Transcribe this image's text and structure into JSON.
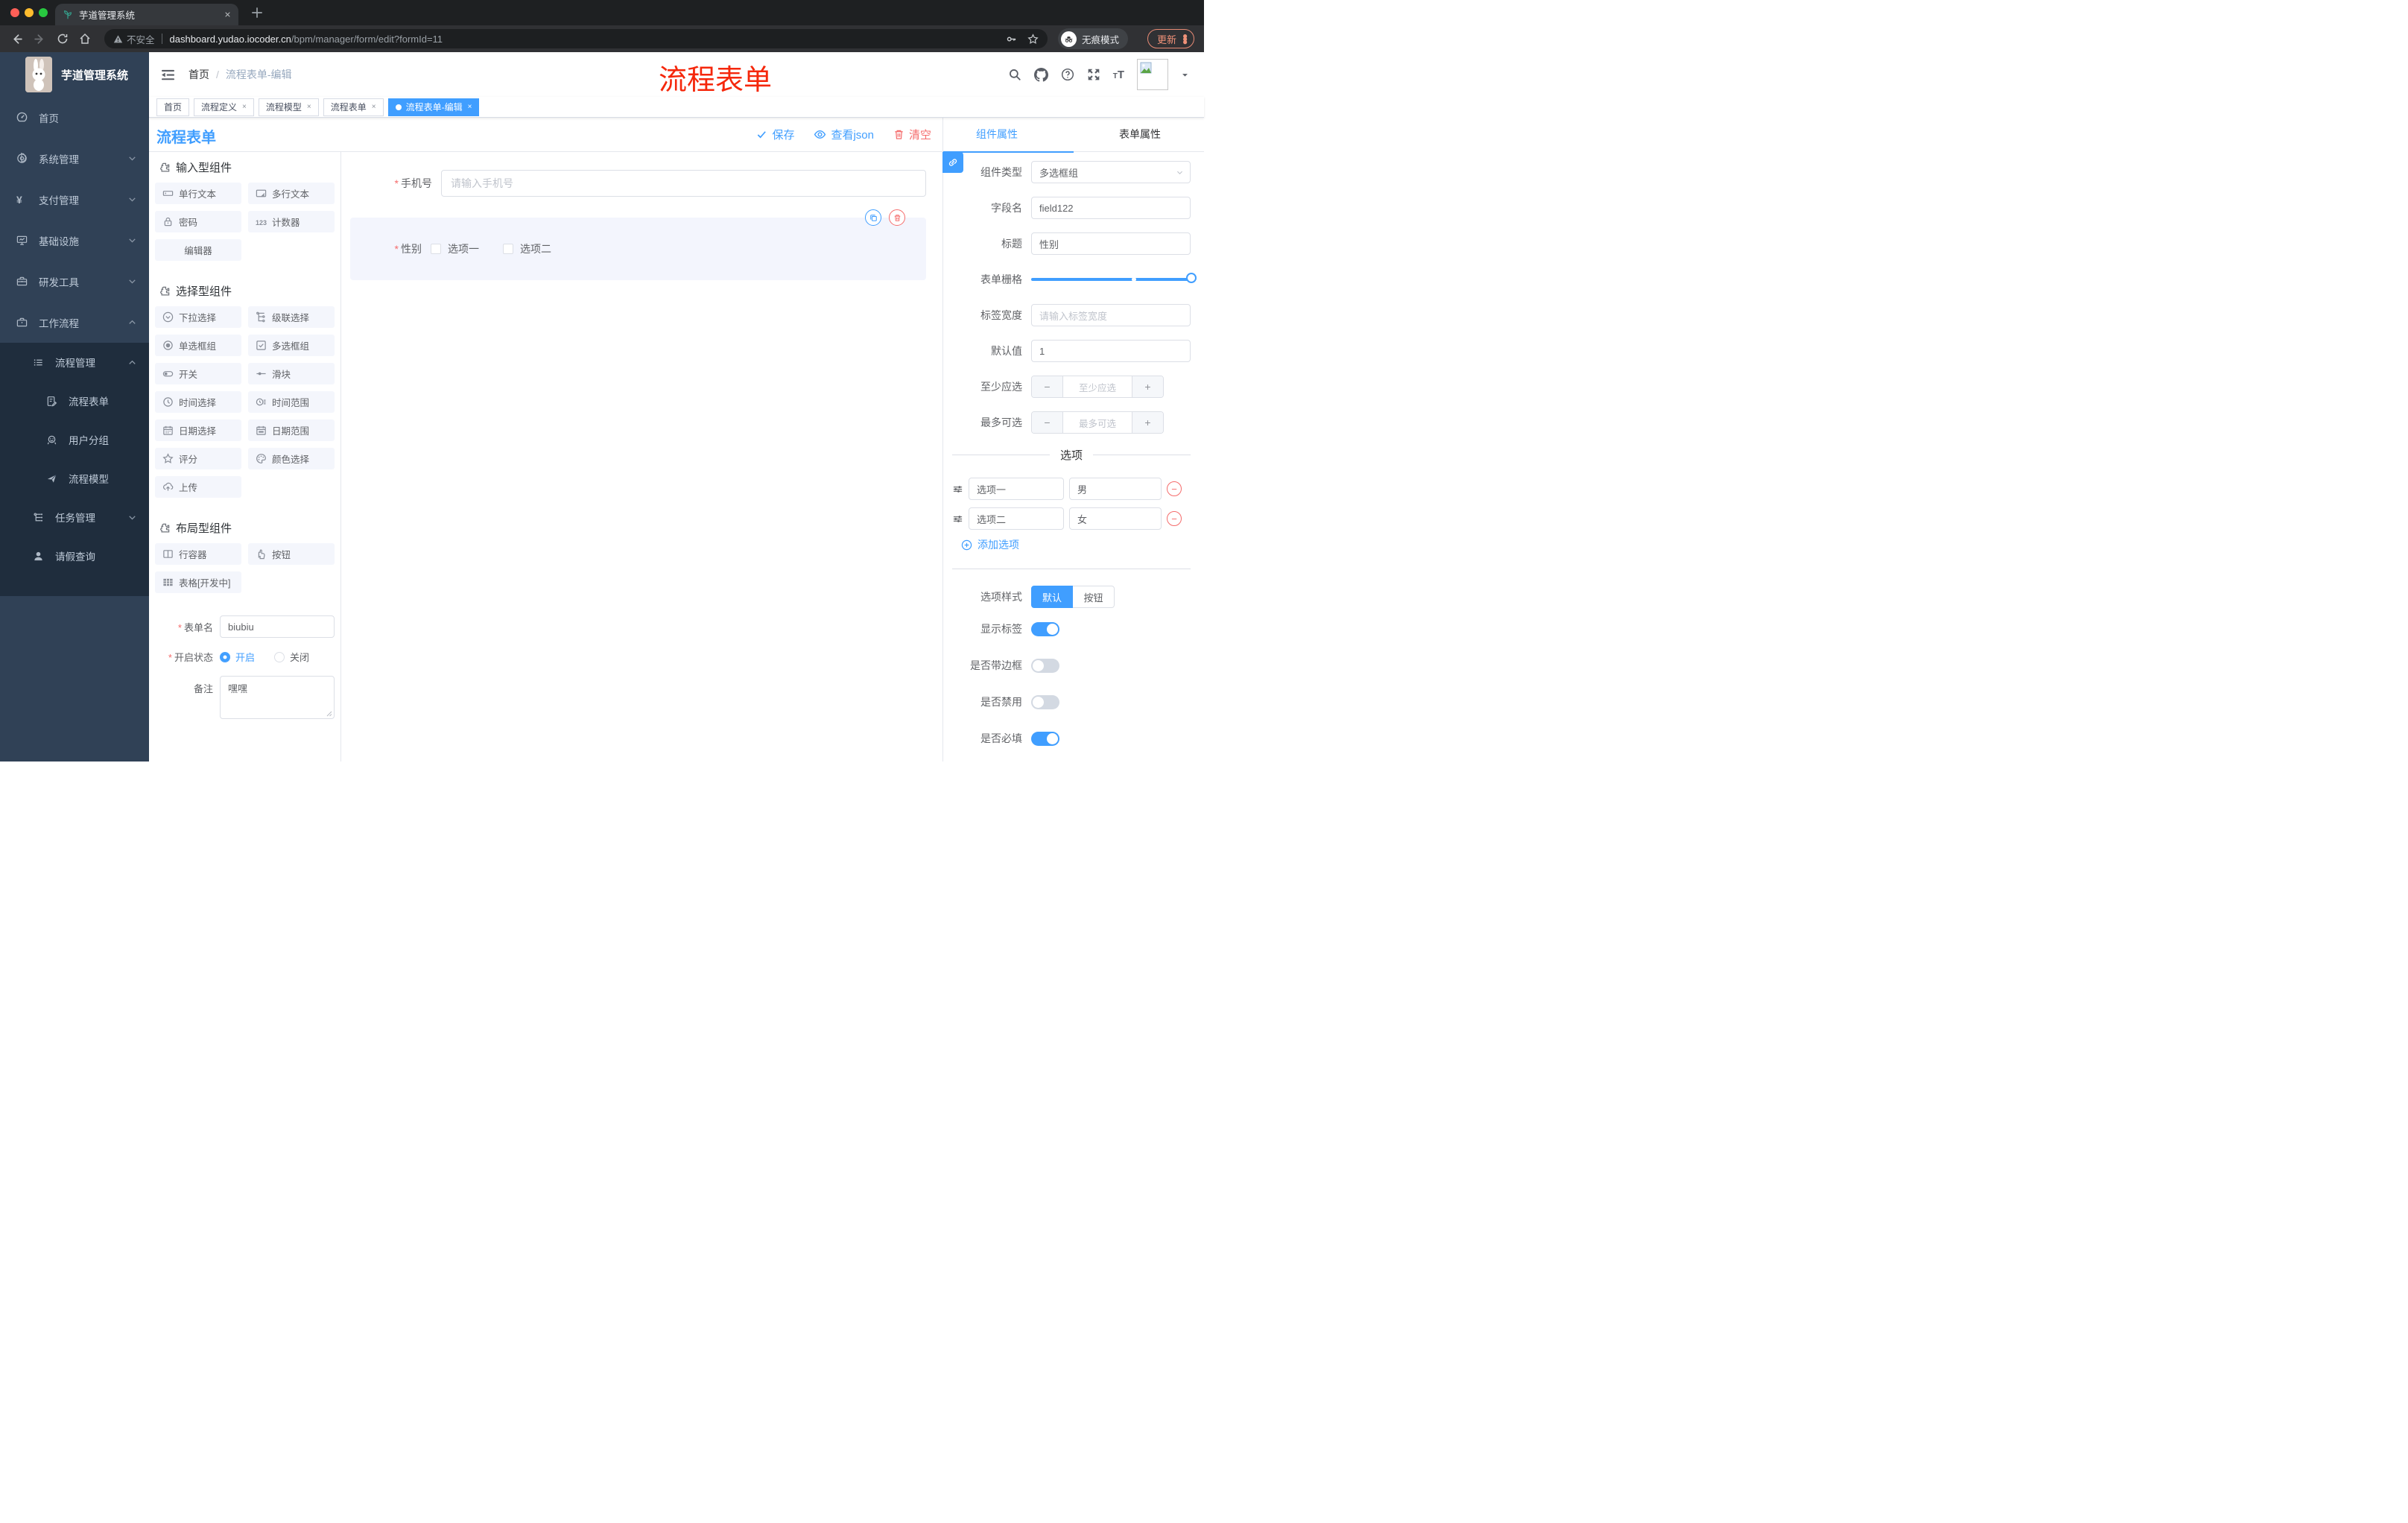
{
  "browser": {
    "tab_title": "芋道管理系统",
    "not_secure": "不安全",
    "url_host": "dashboard.yudao.iocoder.cn",
    "url_path": "/bpm/manager/form/edit?formId=11",
    "incognito_label": "无痕模式",
    "update_label": "更新"
  },
  "sidebar": {
    "logo_title": "芋道管理系统",
    "items": [
      {
        "name": "home",
        "label": "首页",
        "icon": "dashboard-icon",
        "indent": 1,
        "chevron": null,
        "dark": false
      },
      {
        "name": "system",
        "label": "系统管理",
        "icon": "gear-icon",
        "indent": 1,
        "chevron": "down",
        "dark": false
      },
      {
        "name": "payment",
        "label": "支付管理",
        "icon": "yen-icon",
        "indent": 1,
        "chevron": "down",
        "dark": false
      },
      {
        "name": "infra",
        "label": "基础设施",
        "icon": "monitor-icon",
        "indent": 1,
        "chevron": "down",
        "dark": false
      },
      {
        "name": "devtools",
        "label": "研发工具",
        "icon": "toolbox-icon",
        "indent": 1,
        "chevron": "down",
        "dark": false
      },
      {
        "name": "workflow",
        "label": "工作流程",
        "icon": "briefcase-icon",
        "indent": 1,
        "chevron": "up",
        "dark": false
      },
      {
        "name": "process-mgmt",
        "label": "流程管理",
        "icon": "list-icon",
        "indent": 2,
        "chevron": "up",
        "dark": true
      },
      {
        "name": "process-form",
        "label": "流程表单",
        "icon": "doc-edit-icon",
        "indent": 3,
        "chevron": null,
        "dark": true
      },
      {
        "name": "user-group",
        "label": "用户分组",
        "icon": "user-group-icon",
        "indent": 3,
        "chevron": null,
        "dark": true
      },
      {
        "name": "process-model",
        "label": "流程模型",
        "icon": "paper-plane-icon",
        "indent": 3,
        "chevron": null,
        "dark": true
      },
      {
        "name": "task-mgmt",
        "label": "任务管理",
        "icon": "tree-icon",
        "indent": 2,
        "chevron": "down",
        "dark": true
      },
      {
        "name": "leave-query",
        "label": "请假查询",
        "icon": "person-icon",
        "indent": 2,
        "chevron": null,
        "dark": true
      }
    ]
  },
  "header": {
    "breadcrumb": {
      "root": "首页",
      "separator": "/",
      "current": "流程表单-编辑"
    },
    "annotation": "流程表单"
  },
  "tags": [
    {
      "name": "home",
      "label": "首页",
      "closable": false,
      "active": false
    },
    {
      "name": "process-def",
      "label": "流程定义",
      "closable": true,
      "active": false
    },
    {
      "name": "process-model",
      "label": "流程模型",
      "closable": true,
      "active": false
    },
    {
      "name": "process-form",
      "label": "流程表单",
      "closable": true,
      "active": false
    },
    {
      "name": "process-form-edit",
      "label": "流程表单-编辑",
      "closable": true,
      "active": true
    }
  ],
  "page": {
    "title": "流程表单",
    "toolbar": {
      "save": "保存",
      "view_json": "查看json",
      "clear": "清空"
    }
  },
  "components_panel": {
    "groups": [
      {
        "title": "输入型组件",
        "items": [
          {
            "label": "单行文本",
            "icon": "input-icon"
          },
          {
            "label": "多行文本",
            "icon": "textarea-icon"
          },
          {
            "label": "密码",
            "icon": "lock-icon"
          },
          {
            "label": "计数器",
            "icon": "counter-icon"
          },
          {
            "label": "编辑器",
            "icon": null
          }
        ]
      },
      {
        "title": "选择型组件",
        "items": [
          {
            "label": "下拉选择",
            "icon": "select-icon"
          },
          {
            "label": "级联选择",
            "icon": "cascade-icon"
          },
          {
            "label": "单选框组",
            "icon": "radio-icon"
          },
          {
            "label": "多选框组",
            "icon": "checkbox-icon"
          },
          {
            "label": "开关",
            "icon": "switch-icon"
          },
          {
            "label": "滑块",
            "icon": "slider-icon"
          },
          {
            "label": "时间选择",
            "icon": "clock-icon"
          },
          {
            "label": "时间范围",
            "icon": "time-range-icon"
          },
          {
            "label": "日期选择",
            "icon": "calendar-icon"
          },
          {
            "label": "日期范围",
            "icon": "date-range-icon"
          },
          {
            "label": "评分",
            "icon": "star-icon"
          },
          {
            "label": "颜色选择",
            "icon": "palette-icon"
          },
          {
            "label": "上传",
            "icon": "upload-icon"
          }
        ]
      },
      {
        "title": "布局型组件",
        "items": [
          {
            "label": "行容器",
            "icon": "row-container-icon"
          },
          {
            "label": "按钮",
            "icon": "hand-click-icon"
          },
          {
            "label": "表格[开发中]",
            "icon": "table-icon"
          }
        ]
      }
    ],
    "form": {
      "form_name_label": "表单名",
      "form_name_value": "biubiu",
      "status_label": "开启状态",
      "status_on": "开启",
      "status_off": "关闭",
      "remark_label": "备注",
      "remark_value": "嘿嘿"
    }
  },
  "canvas": {
    "phone_label": "手机号",
    "phone_placeholder": "请输入手机号",
    "gender_label": "性别",
    "gender_options": [
      "选项一",
      "选项二"
    ]
  },
  "props_panel": {
    "tab_component": "组件属性",
    "tab_form": "表单属性",
    "component_type_label": "组件类型",
    "component_type_value": "多选框组",
    "field_name_label": "字段名",
    "field_name_value": "field122",
    "title_label": "标题",
    "title_value": "性别",
    "grid_label": "表单栅格",
    "label_width_label": "标签宽度",
    "label_width_placeholder": "请输入标签宽度",
    "default_label": "默认值",
    "default_value": "1",
    "min_label": "至少应选",
    "min_placeholder": "至少应选",
    "max_label": "最多可选",
    "max_placeholder": "最多可选",
    "options_divider": "选项",
    "options": [
      {
        "label": "选项一",
        "value": "男"
      },
      {
        "label": "选项二",
        "value": "女"
      }
    ],
    "add_option": "添加选项",
    "style_label": "选项样式",
    "style_default": "默认",
    "style_button": "按钮",
    "toggles": [
      {
        "name": "show-label",
        "label": "显示标签",
        "on": true
      },
      {
        "name": "with-border",
        "label": "是否带边框",
        "on": false
      },
      {
        "name": "disabled",
        "label": "是否禁用",
        "on": false
      },
      {
        "name": "required",
        "label": "是否必填",
        "on": true
      }
    ]
  },
  "colors": {
    "accent": "#409eff",
    "danger": "#f56c6c",
    "annotation": "#f5270b",
    "sidebar": "#304156",
    "sidebar_dark": "#1f2d3d"
  }
}
